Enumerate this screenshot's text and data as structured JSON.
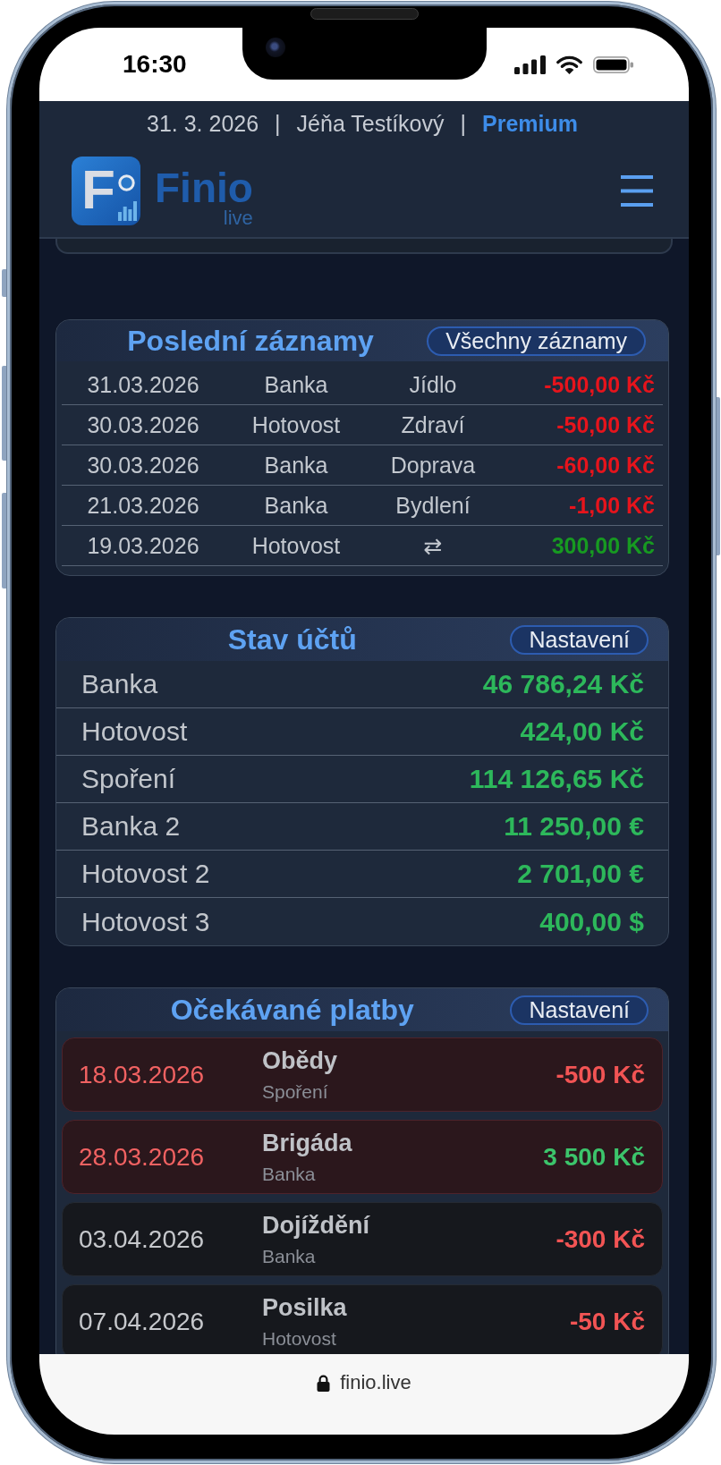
{
  "status_bar": {
    "time": "16:30"
  },
  "header": {
    "info": [
      {
        "kind": "date",
        "text": "31. 3. 2026"
      },
      {
        "kind": "separator",
        "text": "|"
      },
      {
        "kind": "user",
        "text": "Jéňa Testíkový"
      },
      {
        "kind": "separator",
        "text": "|"
      },
      {
        "kind": "plan",
        "text": "Premium"
      }
    ],
    "logo": {
      "letter": "F",
      "name": "Finio",
      "tagline": "live"
    }
  },
  "recent_records": {
    "title": "Poslední záznamy",
    "button": "Všechny záznamy",
    "rows": [
      {
        "date": "31.03.2026",
        "account": "Banka",
        "category": "Jídlo",
        "amount": "-500,00 Kč",
        "incoming": false
      },
      {
        "date": "30.03.2026",
        "account": "Hotovost",
        "category": "Zdraví",
        "amount": "-50,00 Kč",
        "incoming": false
      },
      {
        "date": "30.03.2026",
        "account": "Banka",
        "category": "Doprava",
        "amount": "-60,00 Kč",
        "incoming": false
      },
      {
        "date": "21.03.2026",
        "account": "Banka",
        "category": "Bydlení",
        "amount": "-1,00 Kč",
        "incoming": false
      },
      {
        "date": "19.03.2026",
        "account": "Hotovost",
        "category": "⇄",
        "amount": "300,00 Kč",
        "incoming": true
      }
    ]
  },
  "accounts": {
    "title": "Stav účtů",
    "button": "Nastavení",
    "rows": [
      {
        "name": "Banka",
        "balance": "46 786,24 Kč"
      },
      {
        "name": "Hotovost",
        "balance": "424,00 Kč"
      },
      {
        "name": "Spoření",
        "balance": "114 126,65 Kč"
      },
      {
        "name": "Banka 2",
        "balance": "11 250,00 €"
      },
      {
        "name": "Hotovost 2",
        "balance": "2 701,00 €"
      },
      {
        "name": "Hotovost 3",
        "balance": "400,00 $"
      }
    ]
  },
  "expected_payments": {
    "title": "Očekávané platby",
    "button": "Nastavení",
    "items": [
      {
        "date": "18.03.2026",
        "name": "Obědy",
        "account": "Spoření",
        "amount": "-500 Kč",
        "overdue": true,
        "incoming": false
      },
      {
        "date": "28.03.2026",
        "name": "Brigáda",
        "account": "Banka",
        "amount": "3 500 Kč",
        "overdue": true,
        "incoming": true
      },
      {
        "date": "03.04.2026",
        "name": "Dojíždění",
        "account": "Banka",
        "amount": "-300 Kč",
        "overdue": false,
        "incoming": false
      },
      {
        "date": "07.04.2026",
        "name": "Posilka",
        "account": "Hotovost",
        "amount": "-50 Kč",
        "overdue": false,
        "incoming": false
      }
    ]
  },
  "browser_bar": {
    "url": "finio.live"
  }
}
